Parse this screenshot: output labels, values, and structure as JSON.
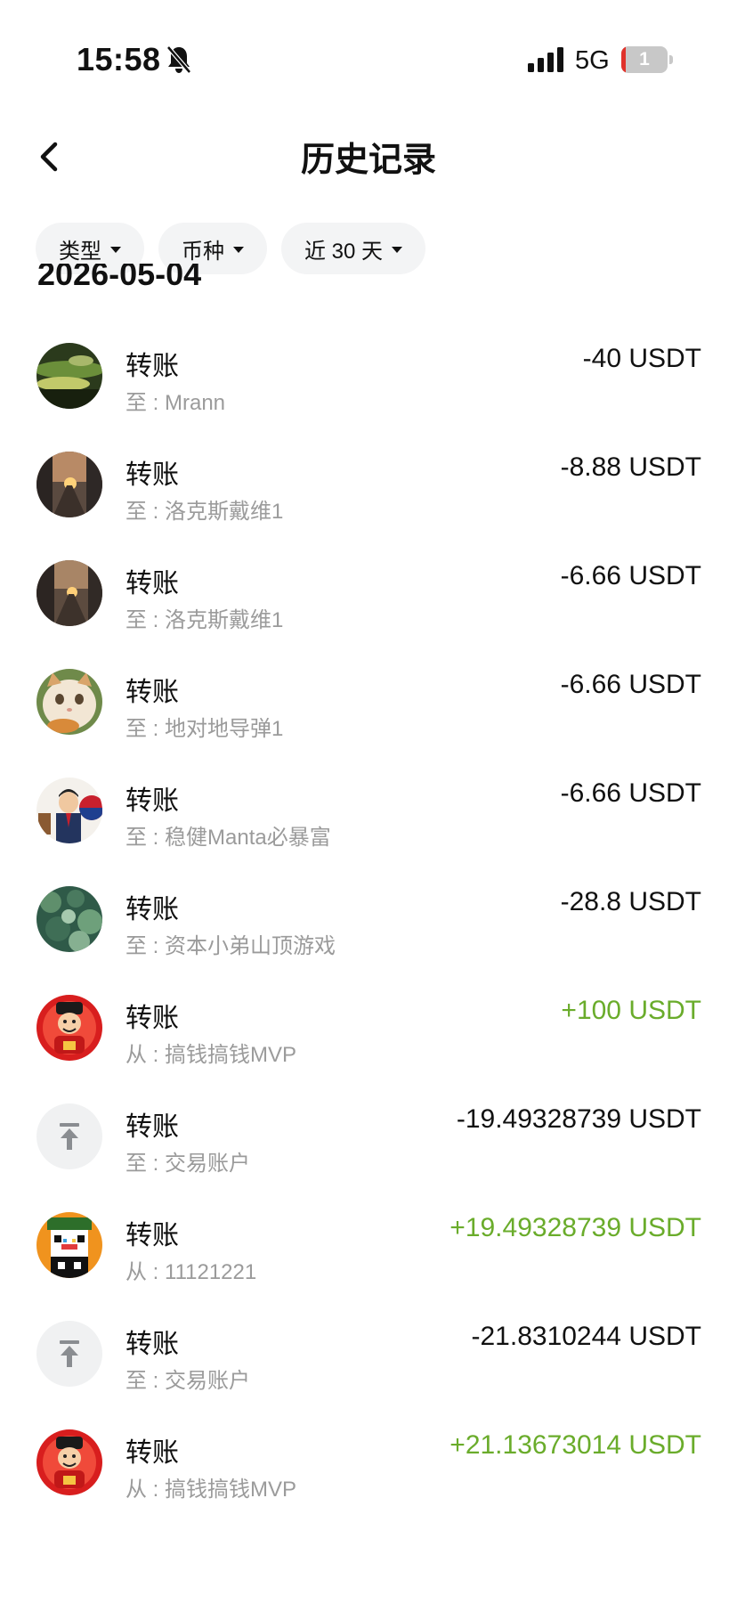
{
  "status_bar": {
    "time": "15:58",
    "network": "5G",
    "battery_level": "1"
  },
  "header": {
    "title": "历史记录"
  },
  "filters": [
    {
      "label": "类型"
    },
    {
      "label": "币种"
    },
    {
      "label": "近 30 天"
    }
  ],
  "date_group": "2026-05-04",
  "colors": {
    "positive": "#6aac2b",
    "negative": "#111111",
    "subtitle": "#9b9b9b",
    "chip_bg": "#f3f4f5"
  },
  "transactions": [
    {
      "title": "转账",
      "subtitle": "至 : Mrann",
      "amount": "-40 USDT",
      "direction": "out",
      "avatar": "green-landscape-avatar"
    },
    {
      "title": "转账",
      "subtitle": "至 : 洛克斯戴维1",
      "amount": "-8.88 USDT",
      "direction": "out",
      "avatar": "sunset-street-avatar"
    },
    {
      "title": "转账",
      "subtitle": "至 : 洛克斯戴维1",
      "amount": "-6.66 USDT",
      "direction": "out",
      "avatar": "sunset-street-avatar"
    },
    {
      "title": "转账",
      "subtitle": "至 : 地对地导弹1",
      "amount": "-6.66 USDT",
      "direction": "out",
      "avatar": "cat-avatar"
    },
    {
      "title": "转账",
      "subtitle": "至 : 稳健Manta必暴富",
      "amount": "-6.66 USDT",
      "direction": "out",
      "avatar": "cartoon-man-avatar"
    },
    {
      "title": "转账",
      "subtitle": "至 : 资本小弟山顶游戏",
      "amount": "-28.8 USDT",
      "direction": "out",
      "avatar": "green-leaves-avatar"
    },
    {
      "title": "转账",
      "subtitle": "从 : 搞钱搞钱MVP",
      "amount": "+100 USDT",
      "direction": "in",
      "avatar": "fortune-god-avatar"
    },
    {
      "title": "转账",
      "subtitle": "至 : 交易账户",
      "amount": "-19.49328739 USDT",
      "direction": "out",
      "avatar": "upload-icon"
    },
    {
      "title": "转账",
      "subtitle": "从 : 11121221",
      "amount": "+19.49328739 USDT",
      "direction": "in",
      "avatar": "pixel-art-avatar"
    },
    {
      "title": "转账",
      "subtitle": "至 : 交易账户",
      "amount": "-21.8310244 USDT",
      "direction": "out",
      "avatar": "upload-icon"
    },
    {
      "title": "转账",
      "subtitle": "从 : 搞钱搞钱MVP",
      "amount": "+21.13673014 USDT",
      "direction": "in",
      "avatar": "fortune-god-avatar"
    }
  ]
}
